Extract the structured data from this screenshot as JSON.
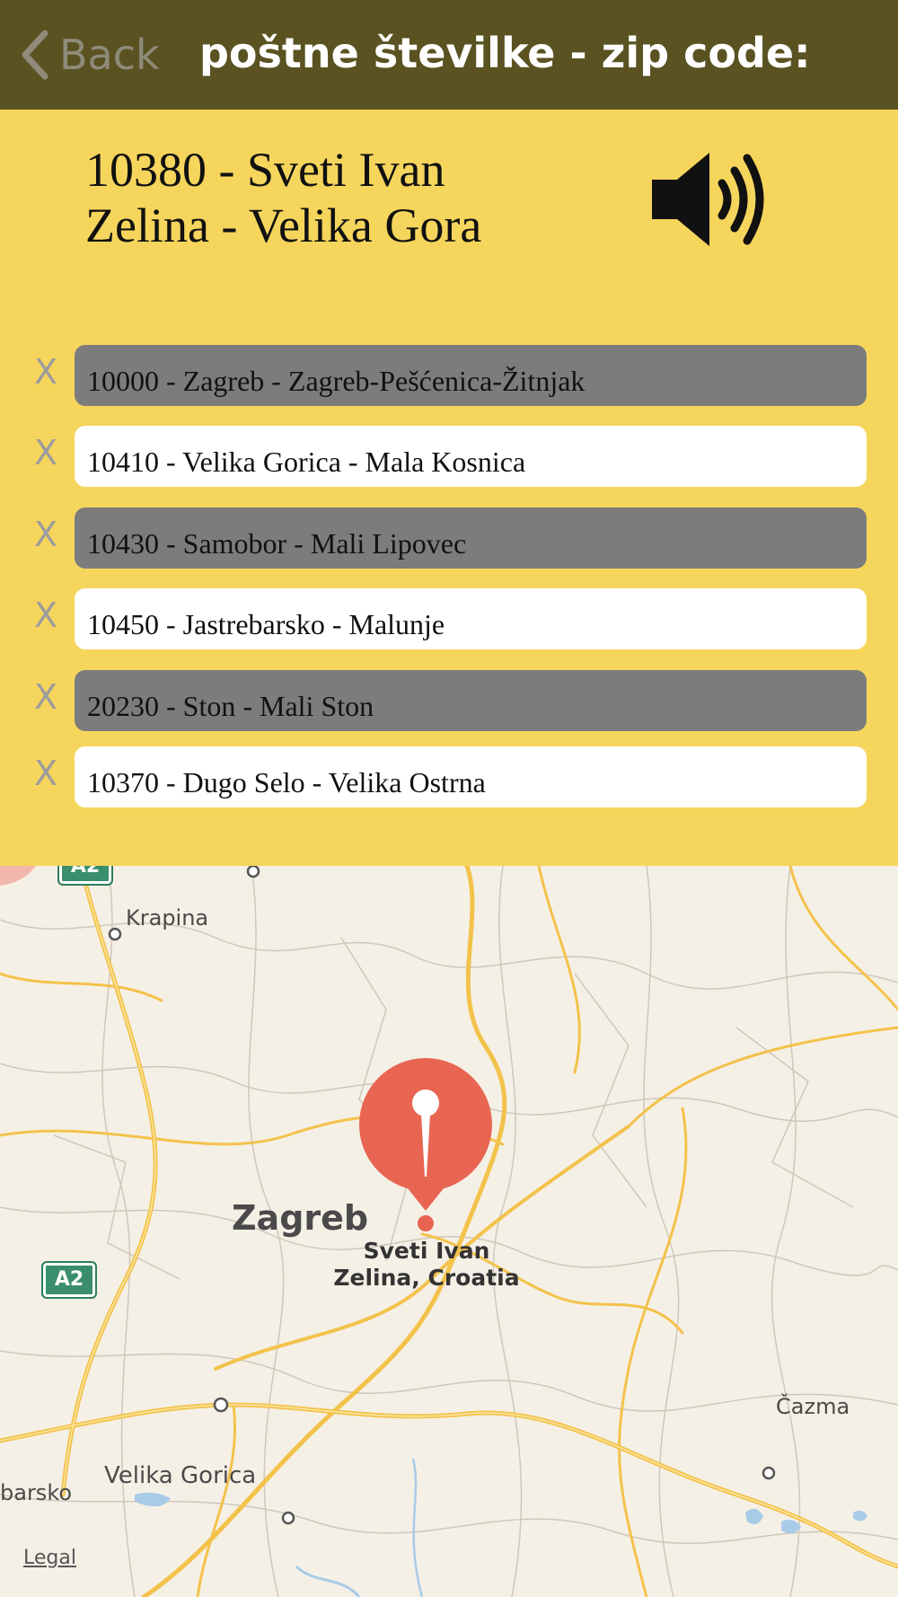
{
  "nav": {
    "back_label": "Back",
    "title": "poštne številke - zip code:"
  },
  "selected": {
    "text": "10380  - Sveti Ivan\nZelina  -  Velika Gora",
    "icon": "speaker-icon"
  },
  "history": [
    {
      "text": "10000  - Zagreb  -  Zagreb-Pešćenica-Žitnjak",
      "remove": "X",
      "style": "gray"
    },
    {
      "text": "10410  - Velika Gorica  -  Mala Kosnica",
      "remove": "X",
      "style": "white"
    },
    {
      "text": "10430  - Samobor  -  Mali Lipovec",
      "remove": "X",
      "style": "gray"
    },
    {
      "text": "10450  - Jastrebarsko  -  Malunje",
      "remove": "X",
      "style": "white"
    },
    {
      "text": "20230  - Ston  -  Mali Ston",
      "remove": "X",
      "style": "gray"
    },
    {
      "text": "10370  - Dugo Selo  -  Velika Ostrna",
      "remove": "X",
      "style": "white"
    }
  ],
  "map": {
    "pin_label": "Sveti Ivan\nZelina, Croatia",
    "places": {
      "krapina": "Krapina",
      "zagreb": "Zagreb",
      "velika_gorica": "Velika Gorica",
      "cazma": "Čazma",
      "samobor_partial": "barsko"
    },
    "highway_shields": {
      "a2_top": "A2",
      "a2_left": "A2"
    },
    "legal": "Legal"
  },
  "colors": {
    "nav_bg": "#5a5221",
    "panel_bg": "#f6d55d",
    "row_gray": "#7c7c7c",
    "row_white": "#ffffff",
    "pin": "#e86552"
  }
}
